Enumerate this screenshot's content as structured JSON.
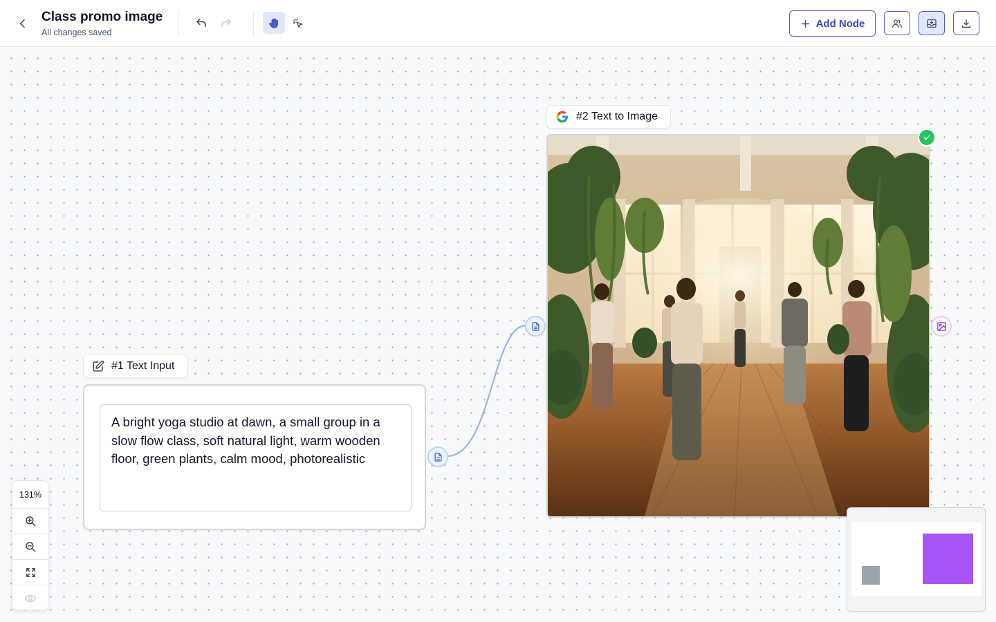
{
  "header": {
    "title": "Class promo image",
    "subtitle": "All changes saved",
    "add_node_label": "Add Node"
  },
  "icons": {
    "back": "chevron-left-icon",
    "undo": "undo-icon",
    "redo": "redo-icon",
    "pan": "hand-icon",
    "select": "pointer-click-icon",
    "add": "plus-icon",
    "users": "users-icon",
    "save": "tray-download-icon",
    "download": "download-icon",
    "edit": "edit-icon",
    "google": "google-logo-icon",
    "check": "check-icon",
    "document": "document-icon",
    "image": "image-icon",
    "zoom_in": "zoom-in-icon",
    "zoom_out": "zoom-out-icon",
    "fit": "fit-view-icon",
    "visibility": "eye-icon"
  },
  "nodes": {
    "text_input": {
      "label": "#1 Text Input",
      "prompt": "A bright yoga studio at dawn, a small group in a slow flow class, soft natural light, warm wooden floor, green plants, calm mood, photorealistic"
    },
    "text_to_image": {
      "label": "#2 Text to Image",
      "status": "complete"
    }
  },
  "zoom": {
    "level": "131%"
  },
  "colors": {
    "accent": "#4f5bd5",
    "edge": "#93b8e6",
    "success": "#22c55e",
    "minimap_image_node": "#a855f7",
    "minimap_text_node": "#9ca3af"
  }
}
